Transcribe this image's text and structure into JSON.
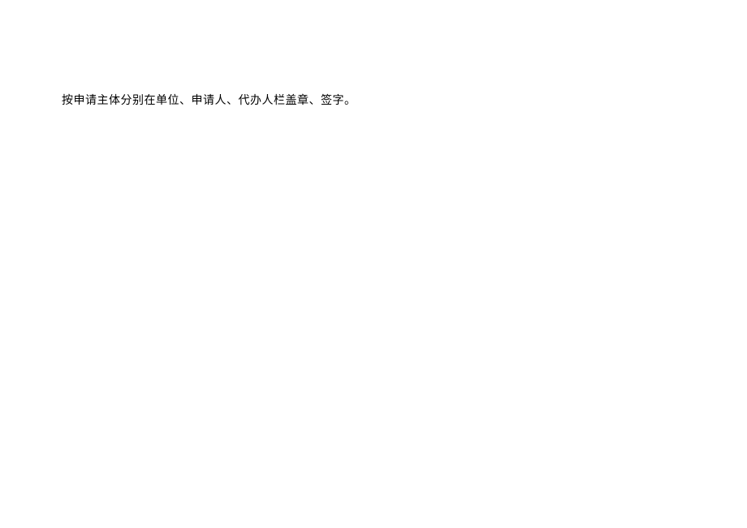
{
  "document": {
    "body_text": "按申请主体分别在单位、申请人、代办人栏盖章、签字。"
  }
}
